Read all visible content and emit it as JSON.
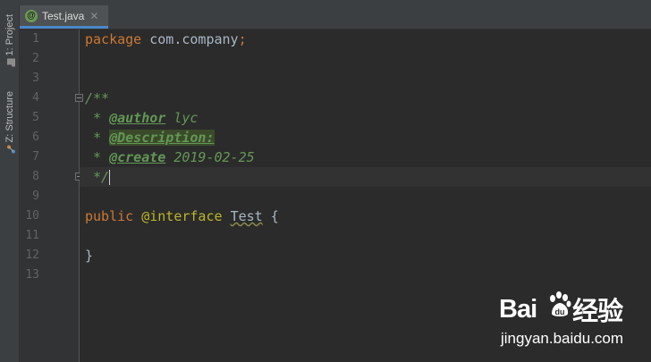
{
  "sidebar": {
    "tabs": [
      {
        "label": "1: Project"
      },
      {
        "label": "Z: Structure"
      }
    ]
  },
  "editor_tabs": [
    {
      "label": "Test.java",
      "icon": "annotation-type-icon",
      "active": true
    }
  ],
  "gutter": {
    "line_numbers": [
      "1",
      "2",
      "3",
      "4",
      "5",
      "6",
      "7",
      "8",
      "9",
      "10",
      "11",
      "12",
      "13"
    ],
    "fold_markers_at": [
      5,
      8
    ]
  },
  "code": {
    "line1": {
      "kw": "package",
      "rest": " com.company",
      "semi": ";"
    },
    "line5": "/**",
    "line6": {
      "prefix": " * ",
      "tag": "@author",
      "text": " lyc"
    },
    "line7": {
      "prefix": " * ",
      "tag": "@Description:"
    },
    "line8": {
      "prefix": " * ",
      "tag": "@create",
      "text": " 2019-02-25"
    },
    "line9": " */",
    "line10": {
      "kw": "public",
      "anno": " @interface",
      "sp": " ",
      "name": "Test",
      "brace": " {"
    },
    "line12": "}"
  },
  "current_line": 8,
  "watermark": {
    "brand_left": "Bai",
    "brand_right": "经验",
    "url": "jingyan.baidu.com"
  },
  "colors": {
    "background": "#2b2b2b",
    "gutter": "#313335",
    "keyword": "#cc7832",
    "doc_comment": "#629755",
    "annotation": "#bbb529",
    "accent": "#4a88c7"
  }
}
